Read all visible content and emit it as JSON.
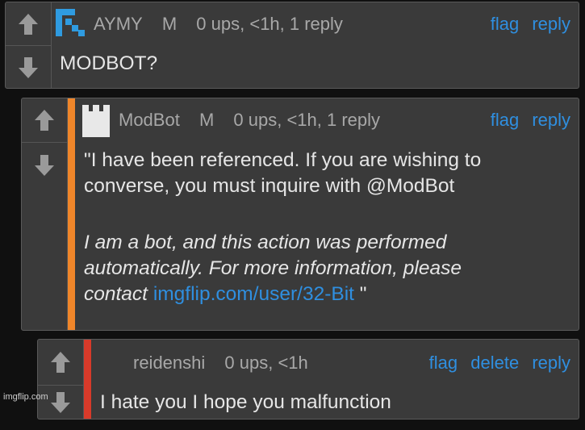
{
  "comments": [
    {
      "username": "AYMY",
      "mod_badge": "M",
      "stats": "0 ups, <1h, 1 reply",
      "actions": [
        "flag",
        "reply"
      ],
      "text": "MODBOT?"
    },
    {
      "username": "ModBot",
      "mod_badge": "M",
      "stats": "0 ups, <1h, 1 reply",
      "actions": [
        "flag",
        "reply"
      ],
      "line1": "\"I have been referenced. If you are wishing to",
      "line2": "converse, you must inquire with @ModBot",
      "italic1": "I am a bot, and this action was performed",
      "italic2": "automatically. For more information, please",
      "italic3": "contact ",
      "link": "imgflip.com/user/32-Bit",
      "closing": " \"",
      "accent_color": "#f0862a"
    },
    {
      "username": "reidenshi",
      "stats": "0 ups, <1h",
      "actions": [
        "flag",
        "delete",
        "reply"
      ],
      "text": "I hate you I hope you malfunction",
      "accent_color": "#d83a2a"
    }
  ],
  "watermark": "imgflip.com"
}
